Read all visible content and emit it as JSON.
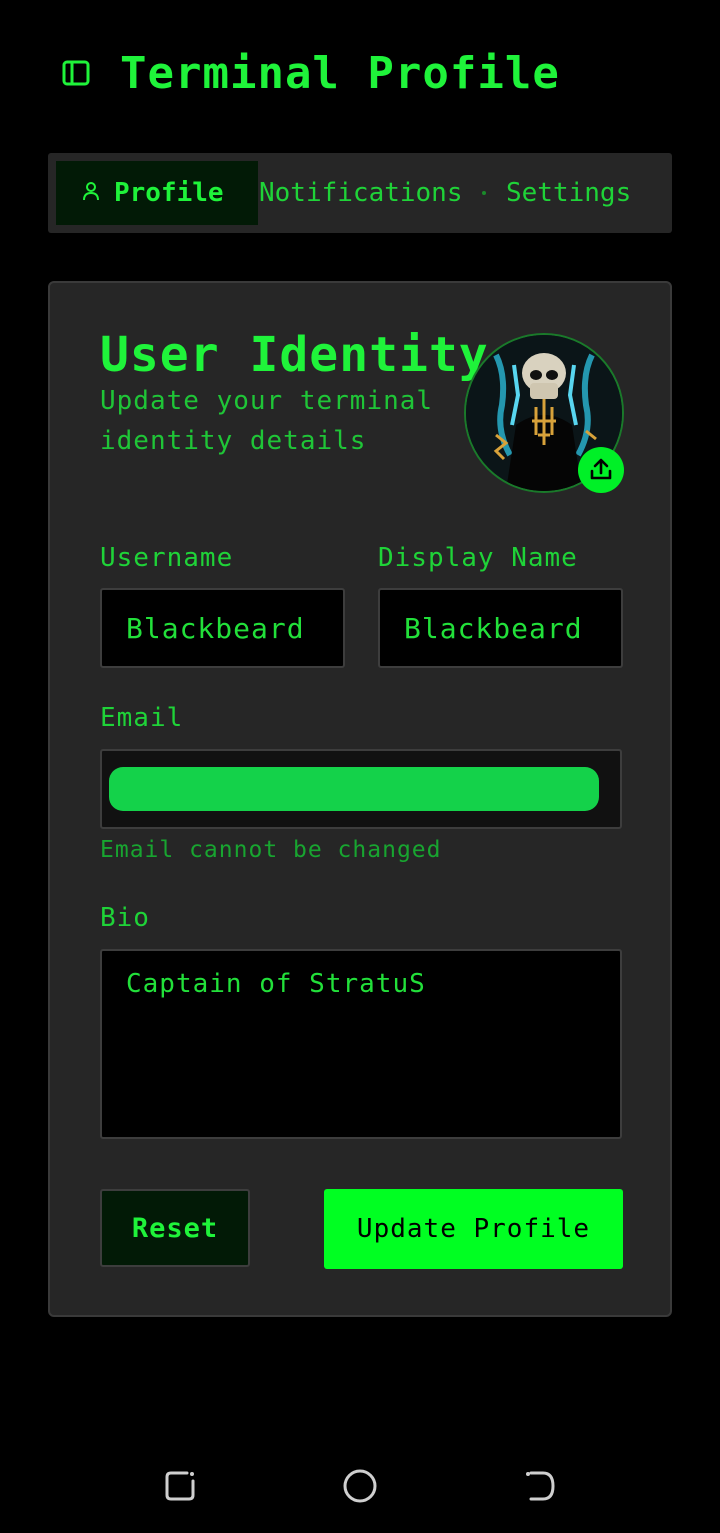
{
  "header": {
    "title": "Terminal Profile",
    "icon": "sidebar-panel-icon"
  },
  "tabs": [
    {
      "label": "Profile",
      "icon": "user-icon",
      "active": true
    },
    {
      "label": "Notifications",
      "active": false
    },
    {
      "label": "Settings",
      "active": false
    }
  ],
  "card": {
    "title": "User Identity",
    "subtitle": "Update your terminal identity details",
    "avatar_icon": "skull-avatar",
    "upload_icon": "upload-icon"
  },
  "form": {
    "username": {
      "label": "Username",
      "value": "Blackbeard"
    },
    "display_name": {
      "label": "Display Name",
      "value": "Blackbeard"
    },
    "email": {
      "label": "Email",
      "hint": "Email cannot be changed"
    },
    "bio": {
      "label": "Bio",
      "value": "Captain of StratuS"
    },
    "reset_label": "Reset",
    "update_label": "Update Profile"
  },
  "colors": {
    "background": "#000000",
    "surface": "#262626",
    "accent": "#00ff22",
    "text": "#1ff33a",
    "email_redaction": "#14d24a"
  },
  "system_nav": {
    "recents_icon": "recents-icon",
    "home_icon": "home-circle-icon",
    "back_icon": "back-icon"
  }
}
